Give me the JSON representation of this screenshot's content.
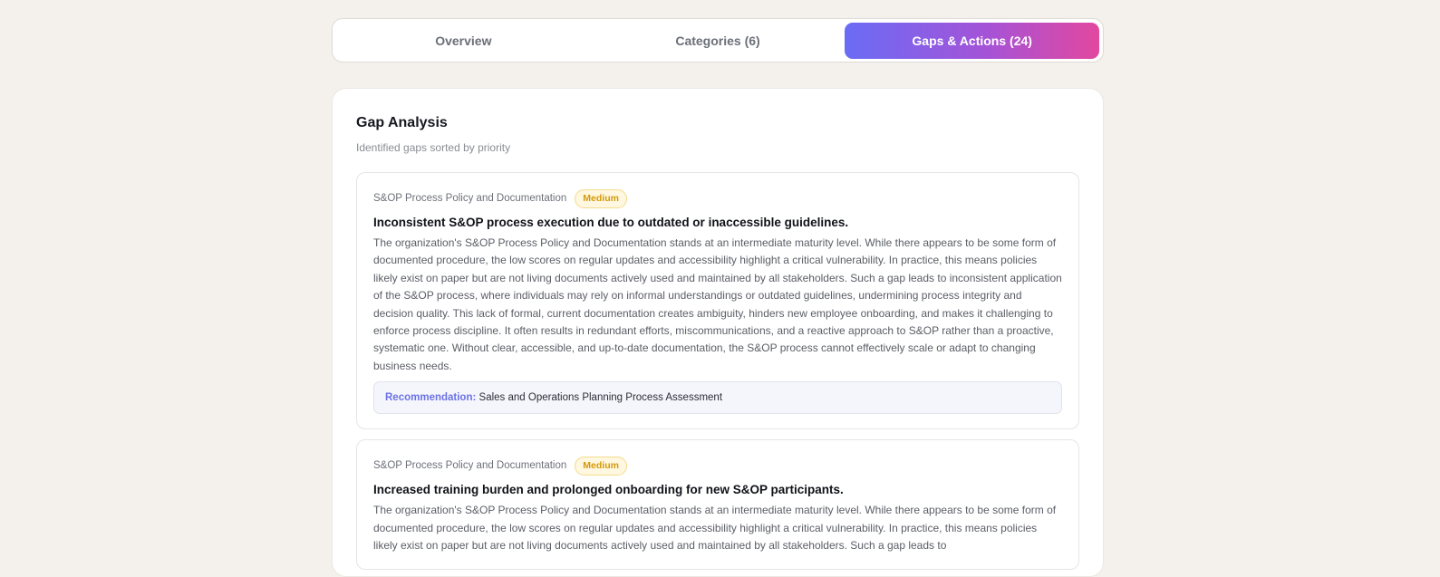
{
  "tabs": [
    {
      "label": "Overview",
      "active": false
    },
    {
      "label": "Categories (6)",
      "active": false
    },
    {
      "label": "Gaps & Actions (24)",
      "active": true
    }
  ],
  "panel": {
    "title": "Gap Analysis",
    "subtitle": "Identified gaps sorted by priority"
  },
  "gaps": [
    {
      "category": "S&OP Process Policy and Documentation",
      "priority": "Medium",
      "title": "Inconsistent S&OP process execution due to outdated or inaccessible guidelines.",
      "description": "The organization's S&OP Process Policy and Documentation stands at an intermediate maturity level. While there appears to be some form of documented procedure, the low scores on regular updates and accessibility highlight a critical vulnerability. In practice, this means policies likely exist on paper but are not living documents actively used and maintained by all stakeholders. Such a gap leads to inconsistent application of the S&OP process, where individuals may rely on informal understandings or outdated guidelines, undermining process integrity and decision quality. This lack of formal, current documentation creates ambiguity, hinders new employee onboarding, and makes it challenging to enforce process discipline. It often results in redundant efforts, miscommunications, and a reactive approach to S&OP rather than a proactive, systematic one. Without clear, accessible, and up-to-date documentation, the S&OP process cannot effectively scale or adapt to changing business needs.",
      "recommendation_label": "Recommendation:",
      "recommendation": "Sales and Operations Planning Process Assessment"
    },
    {
      "category": "S&OP Process Policy and Documentation",
      "priority": "Medium",
      "title": "Increased training burden and prolonged onboarding for new S&OP participants.",
      "description": "The organization's S&OP Process Policy and Documentation stands at an intermediate maturity level. While there appears to be some form of documented procedure, the low scores on regular updates and accessibility highlight a critical vulnerability. In practice, this means policies likely exist on paper but are not living documents actively used and maintained by all stakeholders. Such a gap leads to"
    }
  ],
  "colors": {
    "background": "#f4f1ec",
    "accent_gradient_start": "#6a6cf5",
    "accent_gradient_end": "#e2489f",
    "medium_badge": "#d49a0a",
    "recommendation_label": "#6b72e6"
  }
}
